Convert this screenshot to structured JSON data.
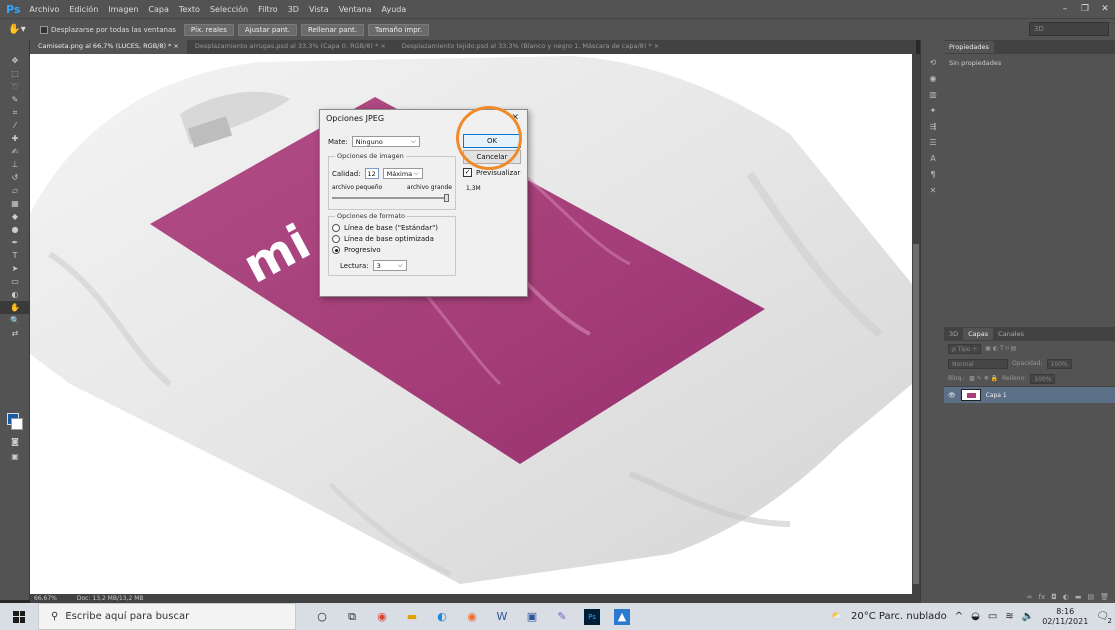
{
  "app": {
    "logo": "Ps",
    "menu": [
      "Archivo",
      "Edición",
      "Imagen",
      "Capa",
      "Texto",
      "Selección",
      "Filtro",
      "3D",
      "Vista",
      "Ventana",
      "Ayuda"
    ]
  },
  "options_bar": {
    "scroll_all_label": "Desplazarse por todas las ventanas",
    "buttons": [
      "Píx. reales",
      "Ajustar pant.",
      "Rellenar pant.",
      "Tamaño impr."
    ],
    "workspace": "3D"
  },
  "doc_tabs": [
    "Camiseta.png al 66,7% (LUCES, RGB/8) * ×",
    "Desplazamiento arrugas.psd al 33,3% (Capa 0, RGB/8) * ×",
    "Desplazamiento tejido.psd al 33,3% (Blanco y negro 1, Máscara de capa/8) * ×"
  ],
  "status": {
    "zoom": "66,67%",
    "doc": "Doc: 13,2 MB/13,2 MB"
  },
  "canvas_text": "mi",
  "properties": {
    "tab": "Propiedades",
    "body": "Sin propiedades"
  },
  "layers": {
    "tabs": [
      "3D",
      "Capas",
      "Canales"
    ],
    "filter_label": "Tipo",
    "blend_mode": "Normal",
    "opacity_label": "Opacidad:",
    "opacity_value": "100%",
    "lock_label": "Bloq.:",
    "fill_label": "Relleno:",
    "fill_value": "100%",
    "items": [
      {
        "name": "Capa 1"
      }
    ]
  },
  "dialog": {
    "title": "Opciones JPEG",
    "matte_label": "Mate:",
    "matte_value": "Ninguno",
    "image_options_label": "Opciones de imagen",
    "quality_label": "Calidad:",
    "quality_value": "12",
    "quality_preset": "Máxima",
    "small_file_label": "archivo pequeño",
    "large_file_label": "archivo grande",
    "format_options_label": "Opciones de formato",
    "format_options": [
      {
        "label": "Línea de base (\"Estándar\")",
        "selected": false
      },
      {
        "label": "Línea de base optimizada",
        "selected": false
      },
      {
        "label": "Progresivo",
        "selected": true
      }
    ],
    "scans_label": "Lectura:",
    "scans_value": "3",
    "ok_label": "OK",
    "cancel_label": "Cancelar",
    "preview_label": "Previsualizar",
    "preview_checked": true,
    "file_size": "1,3M"
  },
  "taskbar": {
    "search_placeholder": "Escribe aquí para buscar",
    "weather": "20°C  Parc. nublado",
    "time": "8:16",
    "date": "02/11/2021",
    "notifications": "2"
  },
  "colors": {
    "accent_orange": "#f08a2a",
    "print_magenta": "#a83f7a",
    "ps_blue": "#31a8ff"
  }
}
